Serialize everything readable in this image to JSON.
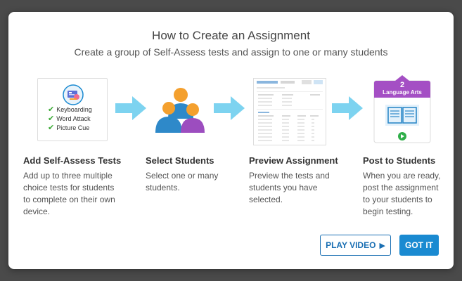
{
  "dialog": {
    "title": "How to Create an Assignment",
    "subtitle": "Create a group of Self-Assess tests and assign to one or many students"
  },
  "steps": [
    {
      "heading": "Add Self-Assess Tests",
      "lines": [
        "Add up to three multiple",
        "choice tests for students",
        "to complete on their own",
        "device."
      ],
      "checklist": [
        "Keyboarding",
        "Word Attack",
        "Picture Cue"
      ]
    },
    {
      "heading": "Select Students",
      "lines": [
        "Select one or many",
        "students."
      ]
    },
    {
      "heading": "Preview Assignment",
      "lines": [
        "Preview the tests and",
        "students you have",
        "selected."
      ]
    },
    {
      "heading": "Post to Students",
      "lines": [
        "When you are ready,",
        "post the assignment",
        "to your students to",
        "begin testing."
      ],
      "card": {
        "number": "2",
        "subject": "Language Arts"
      }
    }
  ],
  "buttons": {
    "play_video": "PLAY VIDEO",
    "got_it": "GOT IT"
  },
  "colors": {
    "accent": "#1a8ad1",
    "arrow": "#7dd3f0",
    "check": "#3aaa35",
    "people_orange": "#f4a02e",
    "people_blue": "#2e89c9",
    "people_purple": "#9c4dbf",
    "card_purple": "#a44fc4",
    "play_green": "#2fae49"
  },
  "icons": {
    "step1": "test-badge-icon",
    "step2": "students-group-icon",
    "step3": "assignment-preview-thumbnail",
    "step4": "language-arts-card-icon",
    "arrow": "right-arrow-icon",
    "play": "play-triangle-icon"
  }
}
